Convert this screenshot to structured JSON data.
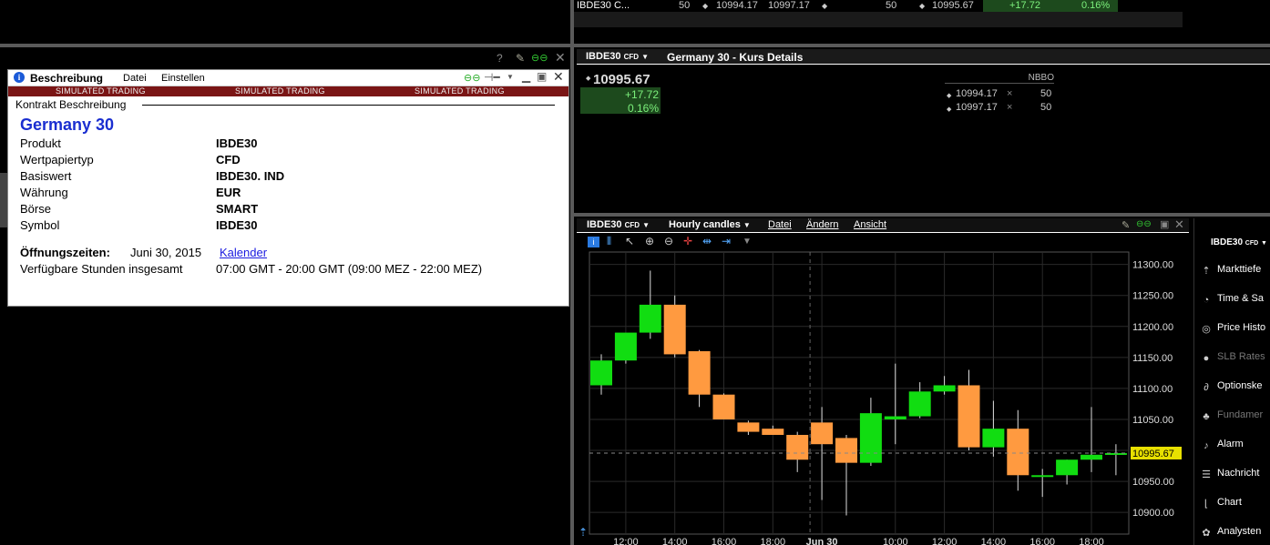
{
  "watchlist": {
    "symbol": "IBDE30 C...",
    "bid_size": "50",
    "bid": "10994.17",
    "ask": "10997.17",
    "ask_size": "50",
    "last": "10995.67",
    "change": "+17.72",
    "change_pct": "0.16%"
  },
  "description_window": {
    "title": "Beschreibung",
    "menu": [
      "Datei",
      "Einstellen"
    ],
    "simulated_label": "SIMULATED TRADING",
    "section_title": "Kontrakt Beschreibung",
    "instrument_name": "Germany 30",
    "fields": [
      {
        "label": "Produkt",
        "value": "IBDE30"
      },
      {
        "label": "Wertpapiertyp",
        "value": "CFD"
      },
      {
        "label": "Basiswert",
        "value": "IBDE30. IND"
      },
      {
        "label": "Währung",
        "value": "EUR"
      },
      {
        "label": "Börse",
        "value": "SMART"
      },
      {
        "label": "Symbol",
        "value": "IBDE30"
      }
    ],
    "hours_label": "Öffnungszeiten:",
    "hours_date": "Juni 30, 2015",
    "calendar_link": "Kalender",
    "total_hours_label": "Verfügbare Stunden insgesamt",
    "total_hours_value": "07:00 GMT - 20:00 GMT (09:00 MEZ - 22:00 MEZ)"
  },
  "quote_window": {
    "symbol": "IBDE30",
    "symbol_suffix": "CFD",
    "title": "Germany 30 - Kurs Details",
    "last": "10995.67",
    "change": "+17.72",
    "change_pct": "0.16%",
    "nbbo_label": "NBBO",
    "bid": "10994.17",
    "ask": "10997.17",
    "bid_size": "50",
    "ask_size": "50",
    "size_sep": "×"
  },
  "chart_window": {
    "symbol": "IBDE30",
    "symbol_suffix": "CFD",
    "timeframe": "Hourly candles",
    "menu": [
      "Datei",
      "Ändern",
      "Ansicht"
    ],
    "last_price_label": "10995.67",
    "colors": {
      "up": "#11dd11",
      "down": "#ff9a40",
      "bg": "#000000",
      "grid": "#2a2a2a"
    }
  },
  "side_panel": {
    "symbol": "IBDE30",
    "symbol_suffix": "CFD",
    "items": [
      {
        "label": "Markttiefe",
        "icon": "market-depth-icon",
        "glyph": "⇡"
      },
      {
        "label": "Time & Sa",
        "icon": "clock-icon",
        "glyph": "◔"
      },
      {
        "label": "Price Histo",
        "icon": "magnifier-icon",
        "glyph": "◎"
      },
      {
        "label": "SLB Rates",
        "icon": "slb-icon",
        "glyph": "●"
      },
      {
        "label": "Optionske",
        "icon": "option-chain-icon",
        "glyph": "∂"
      },
      {
        "label": "Fundamer",
        "icon": "fundamentals-icon",
        "glyph": "♣"
      },
      {
        "label": "Alarm",
        "icon": "alarm-icon",
        "glyph": "♪"
      },
      {
        "label": "Nachricht",
        "icon": "news-rss-icon",
        "glyph": "☰"
      },
      {
        "label": "Chart",
        "icon": "chart-icon",
        "glyph": "⌊"
      },
      {
        "label": "Analysten",
        "icon": "analysts-icon",
        "glyph": "✿"
      }
    ]
  },
  "chart_data": {
    "type": "candlestick",
    "title": "",
    "xlabel": "",
    "ylabel": "",
    "ylim": [
      10865,
      11320
    ],
    "y_ticks": [
      10900,
      10950,
      11000,
      11050,
      11100,
      11150,
      11200,
      11250,
      11300
    ],
    "y_tick_labels": [
      "10900.00",
      "10950.00",
      "11000.00",
      "11050.00",
      "11100.00",
      "11150.00",
      "11200.00",
      "11250.00",
      "11300.00"
    ],
    "x_tick_labels": [
      "12:00",
      "14:00",
      "16:00",
      "18:00",
      "Jun 30",
      "10:00",
      "12:00",
      "14:00",
      "16:00",
      "18:00"
    ],
    "x_tick_candle_index": [
      1,
      3,
      5,
      7,
      9,
      12,
      14,
      16,
      18,
      20
    ],
    "last_price": 10995.67,
    "grid": true,
    "candles": [
      {
        "o": 11105,
        "h": 11155,
        "l": 11090,
        "c": 11145
      },
      {
        "o": 11145,
        "h": 11185,
        "l": 11140,
        "c": 11190
      },
      {
        "o": 11190,
        "h": 11290,
        "l": 11180,
        "c": 11235
      },
      {
        "o": 11235,
        "h": 11250,
        "l": 11150,
        "c": 11155
      },
      {
        "o": 11160,
        "h": 11162,
        "l": 11070,
        "c": 11090
      },
      {
        "o": 11090,
        "h": 11092,
        "l": 11050,
        "c": 11050
      },
      {
        "o": 11045,
        "h": 11048,
        "l": 11025,
        "c": 11030
      },
      {
        "o": 11035,
        "h": 11040,
        "l": 11025,
        "c": 11025
      },
      {
        "o": 11025,
        "h": 11030,
        "l": 10965,
        "c": 10985
      },
      {
        "o": 11045,
        "h": 11070,
        "l": 10920,
        "c": 11010
      },
      {
        "o": 11020,
        "h": 11025,
        "l": 10895,
        "c": 10980
      },
      {
        "o": 10980,
        "h": 11085,
        "l": 10975,
        "c": 11060
      },
      {
        "o": 11050,
        "h": 11140,
        "l": 11010,
        "c": 11055
      },
      {
        "o": 11055,
        "h": 11110,
        "l": 11052,
        "c": 11095
      },
      {
        "o": 11095,
        "h": 11120,
        "l": 11090,
        "c": 11105
      },
      {
        "o": 11105,
        "h": 11130,
        "l": 11000,
        "c": 11005
      },
      {
        "o": 11005,
        "h": 11080,
        "l": 10990,
        "c": 11035
      },
      {
        "o": 11035,
        "h": 11065,
        "l": 10935,
        "c": 10960
      },
      {
        "o": 10960,
        "h": 10970,
        "l": 10925,
        "c": 10960
      },
      {
        "o": 10960,
        "h": 10985,
        "l": 10945,
        "c": 10985
      },
      {
        "o": 10985,
        "h": 11070,
        "l": 10965,
        "c": 10993
      },
      {
        "o": 10995,
        "h": 11010,
        "l": 10960,
        "c": 10995.67
      }
    ]
  }
}
